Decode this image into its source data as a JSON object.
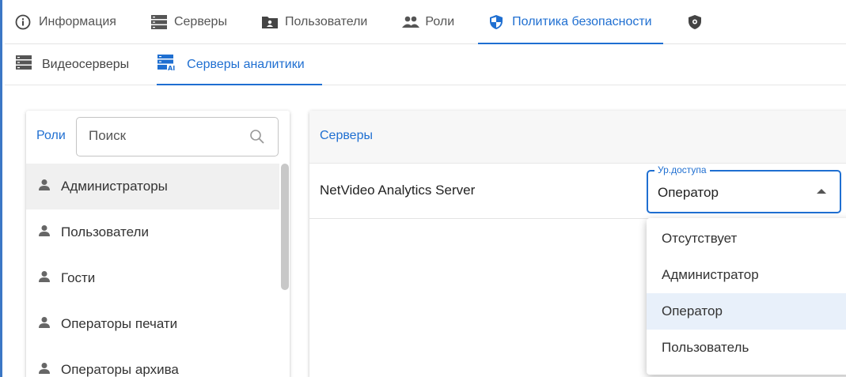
{
  "top_tabs": [
    {
      "label": "Информация",
      "icon": "info-icon",
      "active": false
    },
    {
      "label": "Серверы",
      "icon": "server-icon",
      "active": false
    },
    {
      "label": "Пользователи",
      "icon": "user-folder-icon",
      "active": false
    },
    {
      "label": "Роли",
      "icon": "group-icon",
      "active": false
    },
    {
      "label": "Политика безопасности",
      "icon": "shield-icon",
      "active": true
    }
  ],
  "sub_tabs": [
    {
      "label": "Видеосерверы",
      "icon": "server-icon",
      "active": false
    },
    {
      "label": "Серверы аналитики",
      "icon": "ai-server-icon",
      "active": true
    }
  ],
  "roles": {
    "title": "Роли",
    "search_placeholder": "Поиск",
    "items": [
      {
        "label": "Администраторы",
        "selected": true
      },
      {
        "label": "Пользователи",
        "selected": false
      },
      {
        "label": "Гости",
        "selected": false
      },
      {
        "label": "Операторы печати",
        "selected": false
      },
      {
        "label": "Операторы архива",
        "selected": false
      }
    ]
  },
  "servers": {
    "title": "Серверы",
    "rows": [
      {
        "name": "NetVideo Analytics Server",
        "access_label": "Ур.доступа",
        "access_value": "Оператор"
      }
    ]
  },
  "access_options": [
    {
      "label": "Отсутствует",
      "selected": false
    },
    {
      "label": "Администратор",
      "selected": false
    },
    {
      "label": "Оператор",
      "selected": true
    },
    {
      "label": "Пользователь",
      "selected": false
    }
  ],
  "colors": {
    "accent": "#1f6fd1",
    "frame": "#3b77c5",
    "selected_bg": "#e8f0fa"
  }
}
